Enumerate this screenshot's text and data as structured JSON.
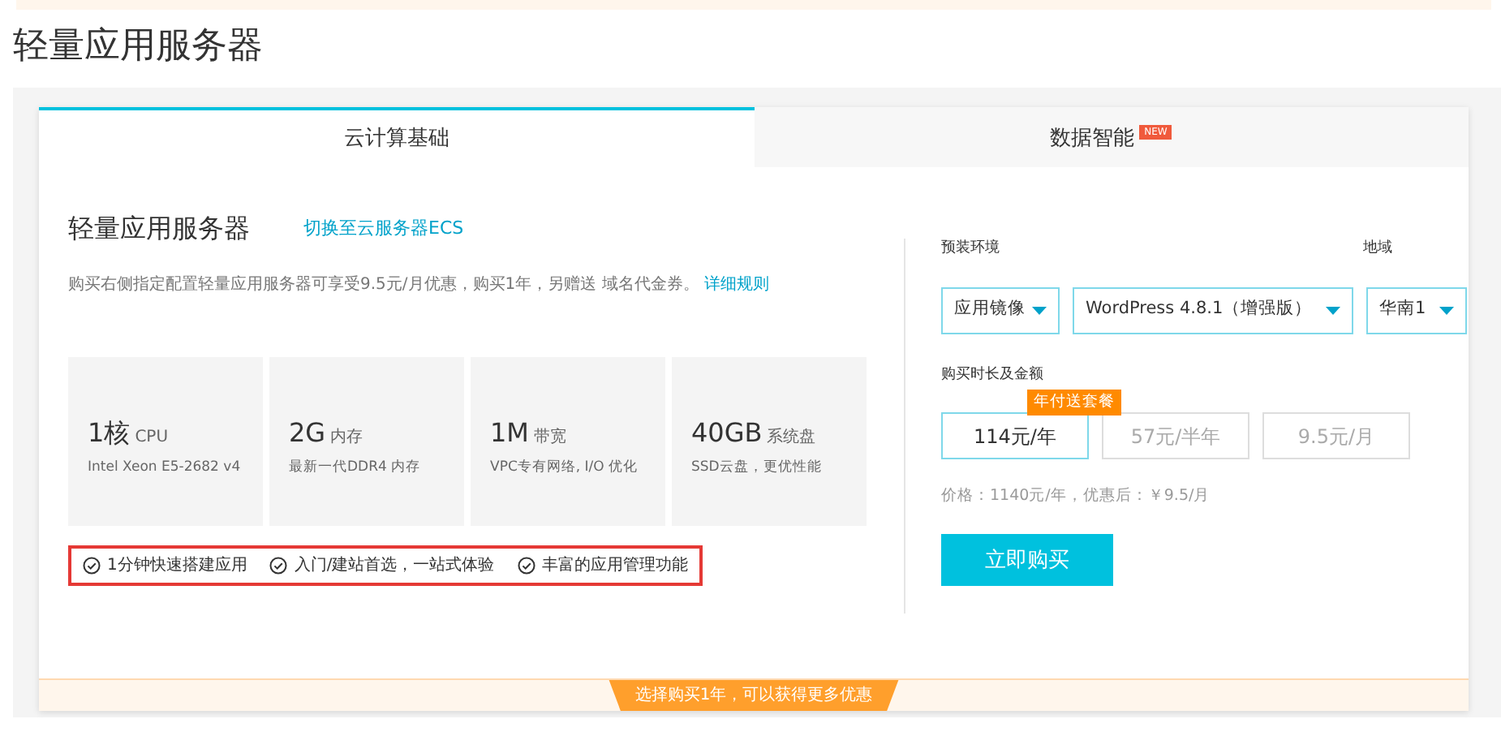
{
  "page_title": "轻量应用服务器",
  "tabs": [
    {
      "label": "云计算基础",
      "selected": true
    },
    {
      "label": "数据智能",
      "selected": false,
      "badge": "NEW"
    }
  ],
  "product": {
    "title": "轻量应用服务器",
    "switch_link": "切换至云服务器ECS",
    "description": "购买右侧指定配置轻量应用服务器可享受9.5元/月优惠，购买1年，另赠送 域名代金券。",
    "rules_link": "详细规则"
  },
  "specs": [
    {
      "value": "1核",
      "unit": "CPU",
      "detail": "Intel Xeon E5-2682 v4"
    },
    {
      "value": "2G",
      "unit": "内存",
      "detail": "最新一代DDR4 内存"
    },
    {
      "value": "1M",
      "unit": "带宽",
      "detail": "VPC专有网络, I/O 优化"
    },
    {
      "value": "40GB",
      "unit": "系统盘",
      "detail": "SSD云盘，更优性能"
    }
  ],
  "features": [
    "1分钟快速搭建应用",
    "入门/建站首选，一站式体验",
    "丰富的应用管理功能"
  ],
  "environment": {
    "label": "预装环境",
    "image_type": "应用镜像",
    "image": "WordPress 4.8.1（增强版）"
  },
  "region": {
    "label": "地域",
    "value": "华南1"
  },
  "duration": {
    "label": "购买时长及金额",
    "tooltip": "年付送套餐",
    "options": [
      {
        "label": "114元/年",
        "selected": true
      },
      {
        "label": "57元/半年",
        "selected": false
      },
      {
        "label": "9.5元/月",
        "selected": false
      }
    ]
  },
  "price_note": "价格：1140元/年，优惠后：￥9.5/月",
  "buy_button": "立即购买",
  "footer_banner": "选择购买1年，可以获得更多优惠"
}
